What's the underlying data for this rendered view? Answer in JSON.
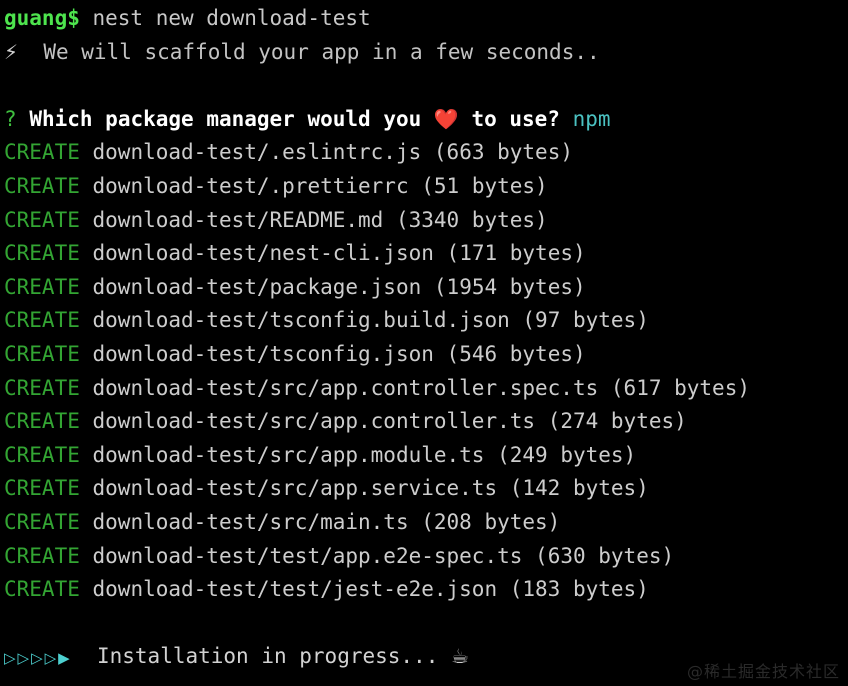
{
  "terminal": {
    "background_color": "#000000",
    "foreground_color": "#cfcfcf",
    "prompt": {
      "user": "guang$",
      "user_color": "#4ee44e",
      "command": " nest new download-test"
    },
    "scaffold": {
      "icon": "high-voltage-emoji",
      "icon_glyph": "⚡",
      "text": "  We will scaffold your app in a few seconds.."
    },
    "question": {
      "marker": "?",
      "marker_color": "#3fbf3f",
      "text_before": "Which package manager would you ",
      "heart_icon": "red-heart-emoji",
      "heart_glyph": "❤️",
      "text_after": " to use?",
      "answer": "npm",
      "answer_color": "#4bc2c2"
    },
    "create_keyword": "CREATE",
    "create_keyword_color": "#33a533",
    "created_files": [
      {
        "path": "download-test/.eslintrc.js",
        "size": "(663 bytes)"
      },
      {
        "path": "download-test/.prettierrc",
        "size": "(51 bytes)"
      },
      {
        "path": "download-test/README.md",
        "size": "(3340 bytes)"
      },
      {
        "path": "download-test/nest-cli.json",
        "size": "(171 bytes)"
      },
      {
        "path": "download-test/package.json",
        "size": "(1954 bytes)"
      },
      {
        "path": "download-test/tsconfig.build.json",
        "size": "(97 bytes)"
      },
      {
        "path": "download-test/tsconfig.json",
        "size": "(546 bytes)"
      },
      {
        "path": "download-test/src/app.controller.spec.ts",
        "size": "(617 bytes)"
      },
      {
        "path": "download-test/src/app.controller.ts",
        "size": "(274 bytes)"
      },
      {
        "path": "download-test/src/app.module.ts",
        "size": "(249 bytes)"
      },
      {
        "path": "download-test/src/app.service.ts",
        "size": "(142 bytes)"
      },
      {
        "path": "download-test/src/main.ts",
        "size": "(208 bytes)"
      },
      {
        "path": "download-test/test/app.e2e-spec.ts",
        "size": "(630 bytes)"
      },
      {
        "path": "download-test/test/jest-e2e.json",
        "size": "(183 bytes)"
      }
    ],
    "status": {
      "spinner_icon": "triangle-spinner-icon",
      "spinner_glyph": "▷▷▷▷▶",
      "spinner_color": "#4dd0d0",
      "text": "  Installation in progress... ",
      "coffee_icon": "hot-beverage-emoji",
      "coffee_glyph": "☕"
    }
  },
  "watermark": {
    "text": "@稀土掘金技术社区"
  }
}
